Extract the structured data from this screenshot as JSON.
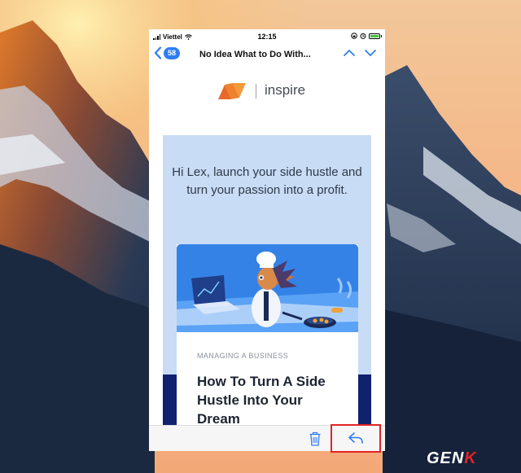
{
  "status_bar": {
    "carrier": "Viettel",
    "time": "12:15"
  },
  "nav": {
    "back_badge": "58",
    "title": "No Idea What to Do With..."
  },
  "email": {
    "brand_name": "inspire",
    "hero_text": "Hi Lex, launch your side hustle and turn your passion into a profit.",
    "card": {
      "category": "MANAGING A BUSINESS",
      "title": "How To Turn A Side Hustle Into Your Dream"
    }
  },
  "toolbar": {
    "trash_icon": "trash-icon",
    "reply_icon": "reply-icon"
  },
  "colors": {
    "accent_blue": "#2f7df6",
    "brand_orange": "#f08a2c",
    "hero_panel": "#c9dcf5",
    "navy": "#10226e",
    "highlight_red": "#e02424"
  },
  "watermark": {
    "text_white": "GEN",
    "text_red": "K"
  }
}
